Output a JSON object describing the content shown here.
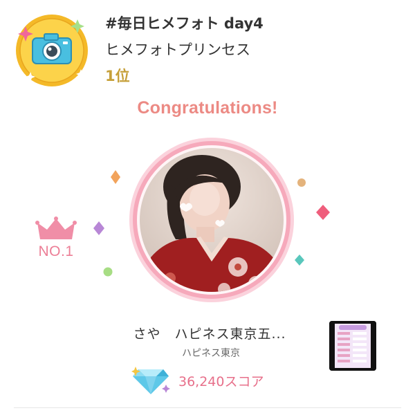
{
  "header": {
    "event_title": "#毎日ヒメフォト day4",
    "award_name": "ヒメフォトプリンセス",
    "rank": "1位"
  },
  "congrats": "Congratulations!",
  "crown": {
    "label": "NO.1"
  },
  "member": {
    "name": "さや　ハピネス東京五...",
    "shop": "ハピネス東京"
  },
  "score": {
    "value": "36,240スコア"
  },
  "icons": {
    "badge": "camera-badge-icon",
    "crown": "crown-icon",
    "score": "diamond-icon"
  },
  "colors": {
    "accent_pink": "#ec8a84",
    "crown_pink": "#ec7e96",
    "score_pink": "#e76f8a",
    "rank_gold": "#c6a03a",
    "badge_gold": "#f4b928",
    "badge_blue": "#49bfe0"
  }
}
